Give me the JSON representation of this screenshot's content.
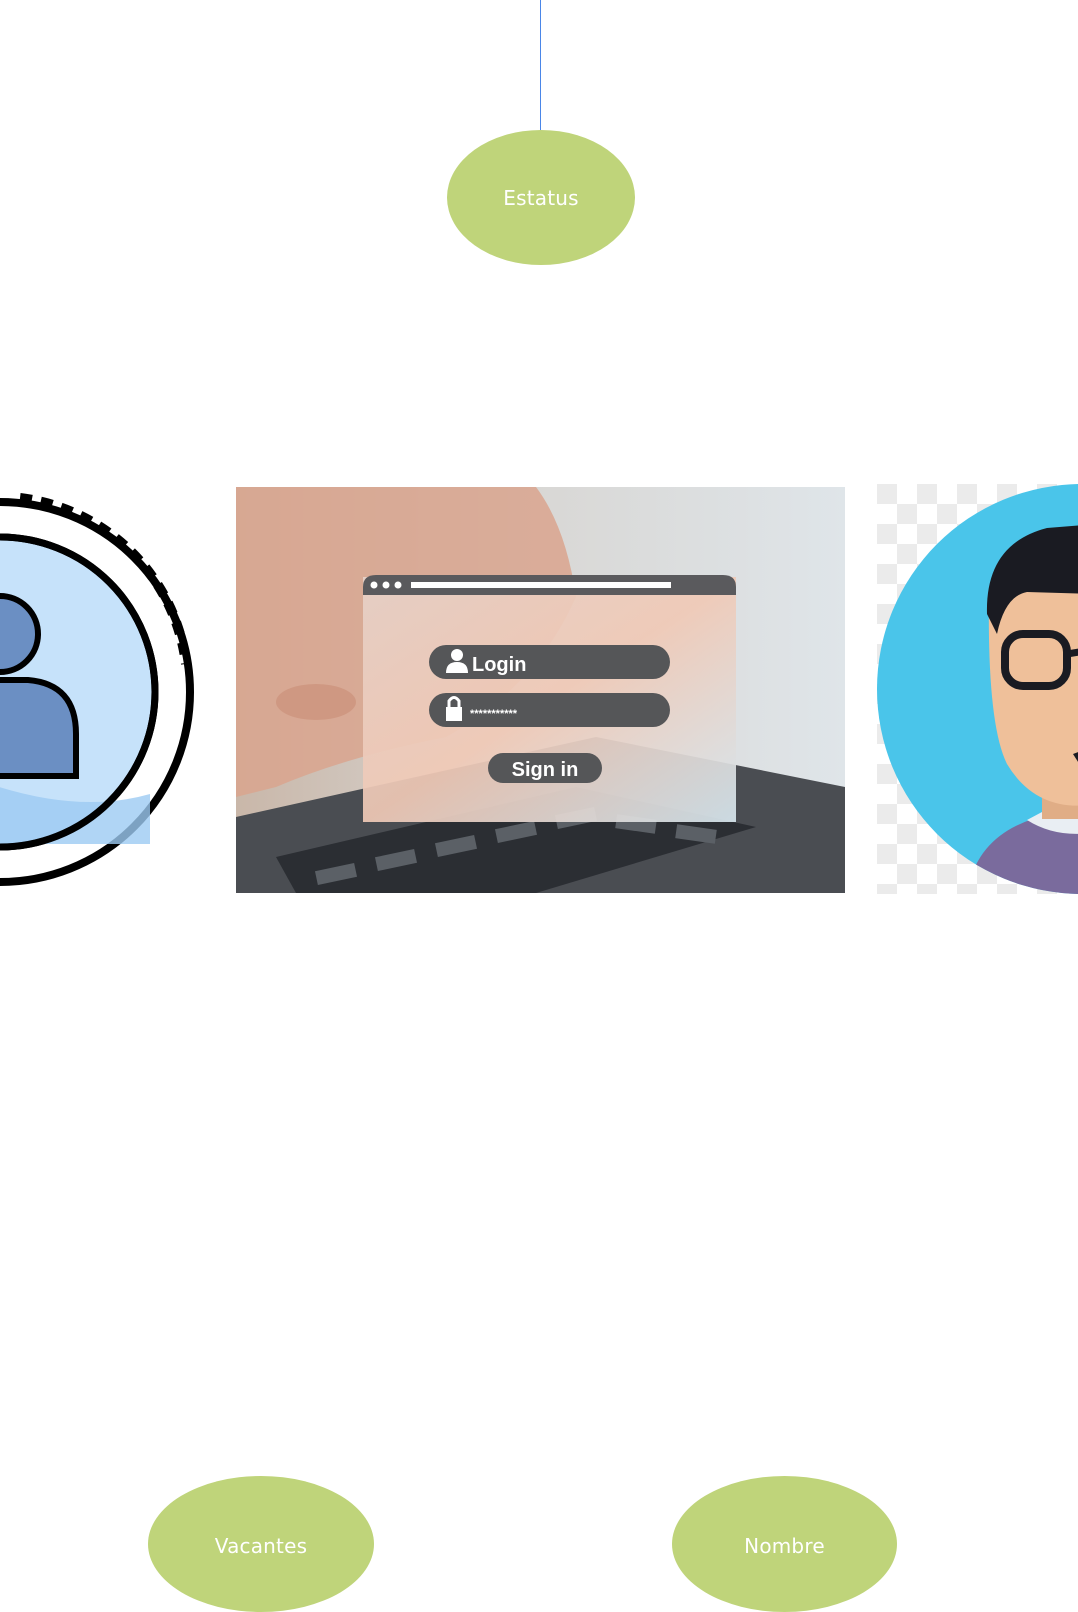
{
  "diagram": {
    "connector_color": "#4a86e8",
    "node_color": "#bfd47a",
    "nodes": {
      "estatus": "Estatus",
      "vacantes": "Vacantes",
      "nombre": "Nombre"
    }
  },
  "images": {
    "login_photo": {
      "login_label": "Login",
      "password_mask": "***********",
      "signin_label": "Sign in"
    },
    "left": {
      "icon": "user-profile-icon"
    },
    "right": {
      "icon": "user-avatar-glasses-icon"
    }
  }
}
